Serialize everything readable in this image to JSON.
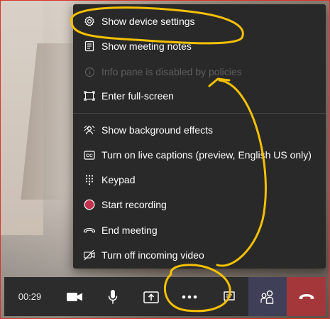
{
  "menu": {
    "items": [
      {
        "label": "Show device settings",
        "icon": "gear-icon"
      },
      {
        "label": "Show meeting notes",
        "icon": "notes-icon"
      },
      {
        "label": "Info pane is disabled by policies",
        "icon": "info-icon"
      },
      {
        "label": "Enter full-screen",
        "icon": "fullscreen-icon"
      },
      {
        "label": "Show background effects",
        "icon": "background-effects-icon"
      },
      {
        "label": "Turn on live captions (preview, English US only)",
        "icon": "captions-icon"
      },
      {
        "label": "Keypad",
        "icon": "keypad-icon"
      },
      {
        "label": "Start recording",
        "icon": "record-icon"
      },
      {
        "label": "End meeting",
        "icon": "end-meeting-icon"
      },
      {
        "label": "Turn off incoming video",
        "icon": "video-off-icon"
      }
    ]
  },
  "toolbar": {
    "time": "00:29",
    "buttons": [
      {
        "icon": "camera-icon"
      },
      {
        "icon": "microphone-icon"
      },
      {
        "icon": "share-screen-icon"
      },
      {
        "icon": "more-options-icon"
      },
      {
        "icon": "chat-icon"
      },
      {
        "icon": "participants-icon"
      },
      {
        "icon": "hang-up-icon"
      }
    ]
  },
  "colors": {
    "menu_bg": "#292929",
    "toolbar_bg": "#2d2c2c",
    "hangup": "#a4373a",
    "participants": "#403f58",
    "record_dot": "#c4314b",
    "annotation": "#f5c000",
    "frame_border": "#d9352b"
  }
}
